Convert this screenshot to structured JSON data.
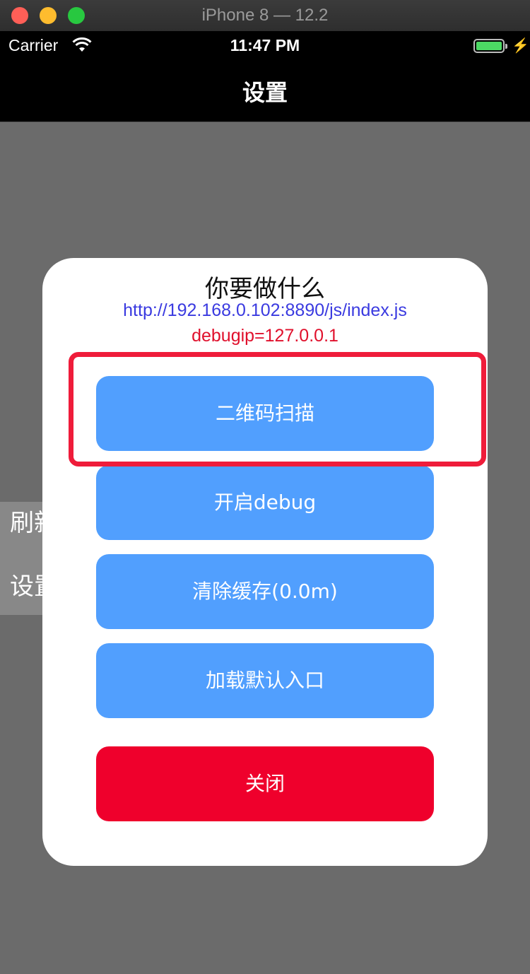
{
  "window": {
    "title": "iPhone 8 — 12.2"
  },
  "status_bar": {
    "carrier": "Carrier",
    "time": "11:47 PM",
    "battery_color": "#4cd964"
  },
  "nav": {
    "title": "设置"
  },
  "side_menu": {
    "items": [
      "刷新",
      "设置"
    ]
  },
  "dialog": {
    "title": "你要做什么",
    "url": "http://192.168.0.102:8890/js/index.js",
    "debugip": "debugip=127.0.0.1",
    "buttons": {
      "scan": "二维码扫描",
      "debug": "开启debug",
      "clear_cache": "清除缓存(0.0m)",
      "load_default": "加载默认入口",
      "close": "关闭"
    }
  },
  "colors": {
    "button_blue": "#519ffe",
    "button_red": "#ef002c",
    "highlight_red": "#ef1c3a",
    "url_blue": "#3a3ae0",
    "debugip_red": "#e0102c"
  }
}
